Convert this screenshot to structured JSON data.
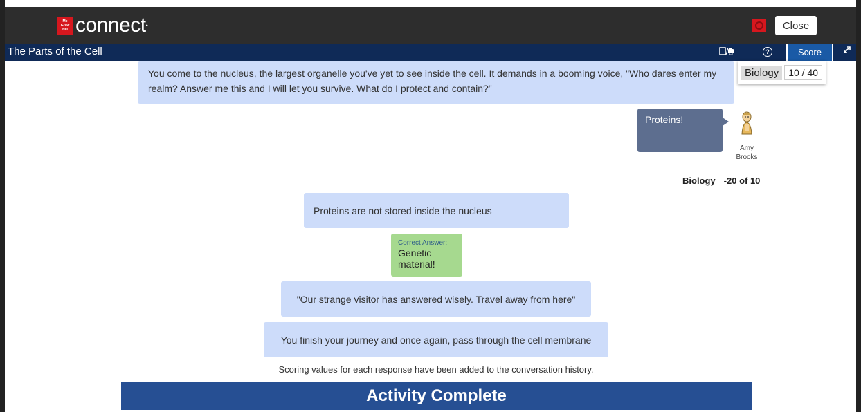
{
  "app": {
    "brand_badge_lines": [
      "Mc",
      "Graw",
      "Hill"
    ],
    "brand_name": "connect",
    "close_label": "Close",
    "stop_icon": "record-stop-icon"
  },
  "titlebar": {
    "title": "The Parts of the Cell",
    "print_icon": "print-icon",
    "help_glyph": "?",
    "score_label": "Score",
    "expand_icon": "expand-icon"
  },
  "score_popup": {
    "subject": "Biology",
    "value": "10 / 40"
  },
  "conversation": {
    "prompt": "You come to the nucleus, the largest organelle you've yet to see inside the cell. It demands in a booming voice, \"Who dares enter my realm? Answer me this and I will let you survive. What do I protect and contain?\"",
    "user_answer": "Proteins!",
    "user_name_first": "Amy",
    "user_name_last": "Brooks",
    "score_subject": "Biology",
    "score_value": "-20 of 10",
    "feedback": "Proteins are not stored inside the nucleus",
    "correct_label": "Correct Answer:",
    "correct_answer": "Genetic material!",
    "reply": "\"Our strange visitor has answered wisely. Travel away from here\"",
    "narration": "You finish your journey and once again, pass through the cell membrane"
  },
  "footer": {
    "scoring_note": "Scoring values for each response have been added to the conversation history.",
    "activity_complete": "Activity Complete"
  },
  "colors": {
    "topbar": "#2d2d2d",
    "titlebar": "#0f2a57",
    "score_tab": "#1a5aa6",
    "bubble": "#cddcfa",
    "answer_bubble": "#5d6e8f",
    "correct": "#a6d98f",
    "activity_bar": "#264f93",
    "brand_red": "#d6171e"
  }
}
